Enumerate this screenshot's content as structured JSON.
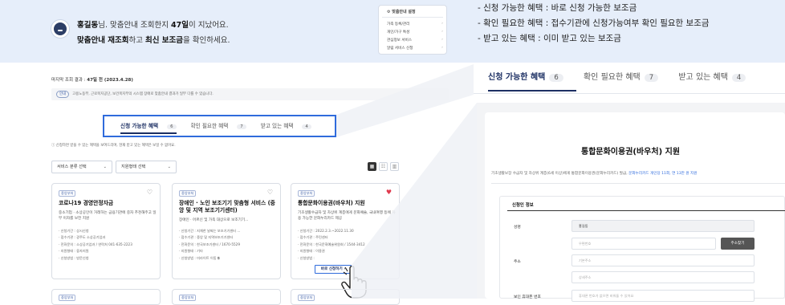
{
  "header": {
    "greeting_name": "홍길동",
    "greeting_mid": "님. 맞춤안내 조회한지 ",
    "greeting_days": "47일",
    "greeting_end": "이 지났어요.",
    "line2_a": "맞춤안내 재조회",
    "line2_b": "하고 ",
    "line2_c": "최신 보조금",
    "line2_d": "을 확인하세요."
  },
  "settings_menu": {
    "title": "맞춤안내 설정",
    "items": [
      "가족 등록/관리",
      "개인/가구 특성",
      "관심정보 서비스",
      "알림 서비스 신청"
    ],
    "chevron": "›"
  },
  "last_query": {
    "label": "마지막 조회 결과 : ",
    "value": "47일 전 (2023.4.28)"
  },
  "notice": {
    "tag": "안내",
    "text": "고용노동부, 근로복지공단, 보건복지부의 시스템 장애로 맞춤안내 결과가 일부 다를 수 있습니다."
  },
  "tabs": [
    {
      "label": "신청 가능한 혜택",
      "count": "6"
    },
    {
      "label": "확인 필요한 혜택",
      "count": "7"
    },
    {
      "label": "받고 있는 혜택",
      "count": "4"
    }
  ],
  "hint": "ⓘ 신청하면 받을 수 있는 혜택을 보여드리며, 현재 받고 있는 혜택은 보일 수 없어요.",
  "filters": {
    "service": "서비스 분류 선택",
    "support": "지원형태 선택",
    "chevron": "⌄"
  },
  "view_buttons": [
    "▦",
    "☷",
    "▥"
  ],
  "cards": [
    {
      "badge": "중앙부처",
      "title": "코로나19 경영안정자금",
      "desc": "중소기업 · 소상공인이 거래하는 금융기관에 중자 추천해주고 일부 이자를 보전 지원",
      "meta": [
        "· 신청기간 : 상시신청",
        "· 접수기관 : 광주도 소상공기업과",
        "· 전화문의 : 소상공기업과 / 연락처 041-635-2223",
        "· 지원형태 : 융자지원",
        "· 신청방법 : 방문신청"
      ]
    },
    {
      "badge": "중앙부처",
      "title": "장애인 · 노인 보조기기 맞춤형 서비스 (중앙 및 지역 보조기기센터)",
      "desc": "장애인 · 어르신 및 가족 대상으로 보조기기...",
      "meta": [
        "· 신청기간 : 지체한 날짜는 보조기기센터 ...",
        "· 접수기관 : 중앙 및 지역보조기기센터",
        "· 전화문의 : 한국보조기센터 / 1670-5529",
        "· 지원형태 : 기타",
        "· 신청방법 : 미라이트 이동 ⧉"
      ]
    },
    {
      "badge": "중앙부처",
      "title": "통합문화이용권(바우처) 지원",
      "desc": "기초생활수급자 및 차상위 계층에게 문화예술, 국내여행 등에 사용 가능한 문화누리카드 제공",
      "meta": [
        "· 신청기간 : 2022.2.3.~2022.11.30",
        "· 접수기관 : 주민센터",
        "· 전화문의 : 한국문화예술위원회 / 1544-3412",
        "· 지원형태 : 이용권",
        "· 신청방법 :"
      ]
    }
  ],
  "apply_button": "바로 신청하기 ›",
  "legend": [
    "- 신청 가능한 혜택 : 바로 신청 가능한 보조금",
    "- 확인 필요한 혜택 : 접수기관에 신청가능여부 확인 필요한 보조금",
    "- 받고 있는 혜택 : 이미 받고 있는 보조금"
  ],
  "detail": {
    "title": "통합문화이용권(바우처) 지원",
    "subtitle": "기초생활보장 수급자 및 차상위 계층(6세 이상)에게 통합문화이용권(문화누리카드) 발급,",
    "subtitle_link": "문화누리카드 개인당 11회, 연 13만 원 지원",
    "section": "신청인 정보",
    "name_label": "성명",
    "name_value": "홍길동",
    "address_label": "주소",
    "zip_placeholder": "우편번호",
    "search_button": "주소찾기",
    "addr1_placeholder": "기본주소",
    "addr2_placeholder": "상세주소",
    "phone_label": "보인 휴대폰 번호",
    "phone_placeholder": "휴대폰 번호가 없으면 비워둘 수 있어요"
  },
  "colors": {
    "accent": "#2f6bdc",
    "navy": "#1c2f63",
    "banner": "#e6eefa",
    "heart_on": "#e03a4e"
  }
}
